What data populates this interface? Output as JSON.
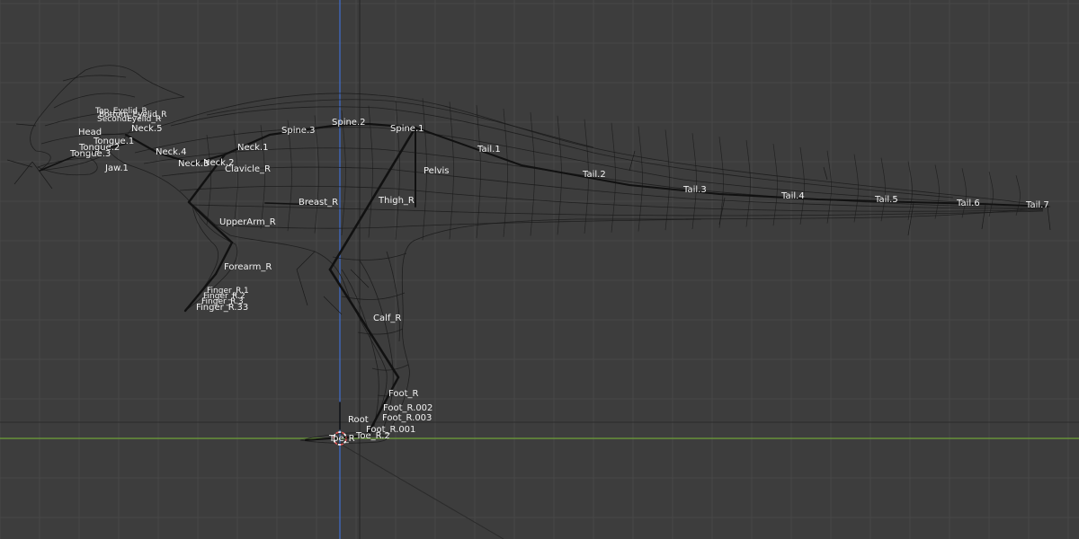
{
  "viewport": {
    "name": "3D Viewport - Right Orthographic",
    "background_color": "#3d3d3d",
    "grid_color": "#484848",
    "grid_major_color": "#4f4f4f",
    "x_axis_color": "#6fa23a",
    "z_axis_color": "#3f6fd0",
    "mesh_wire_color": "#1a1a1a",
    "bone_color": "#111111",
    "label_color": "#f2f2f2",
    "cursor_color": "#e05555"
  },
  "bones": {
    "eyelid_top": "Top_Eyelid_R",
    "eyelid_bottom": "Bottom_Eyelid_R",
    "second_eyelid": "SecondEyelid_R",
    "head": "Head",
    "neck5": "Neck.5",
    "tongue1": "Tongue.1",
    "tongue2": "Tongue.2",
    "tongue3": "Tongue.3",
    "neck4": "Neck.4",
    "jaw1": "Jaw.1",
    "neck3": "Neck.3",
    "neck2": "Neck.2",
    "neck1": "Neck.1",
    "clavicle": "Clavicle_R",
    "spine3": "Spine.3",
    "spine2": "Spine.2",
    "spine1": "Spine.1",
    "pelvis": "Pelvis",
    "tail1": "Tail.1",
    "tail2": "Tail.2",
    "tail3": "Tail.3",
    "tail4": "Tail.4",
    "tail5": "Tail.5",
    "tail6": "Tail.6",
    "tail7": "Tail.7",
    "breast": "Breast_R",
    "thigh": "Thigh_R",
    "upperarm": "UpperArm_R",
    "forearm": "Forearm_R",
    "finger_a": "Finger_R.1",
    "finger_b": "Finger_R.2",
    "finger_c": "Finger_R.3",
    "finger_d": "Finger_R.33",
    "calf": "Calf_R",
    "foot": "Foot_R",
    "foot002": "Foot_R.002",
    "foot003": "Foot_R.003",
    "root": "Root",
    "foot001": "Foot_R.001",
    "toe": "Toe_R",
    "toe2": "Toe_R.2"
  }
}
